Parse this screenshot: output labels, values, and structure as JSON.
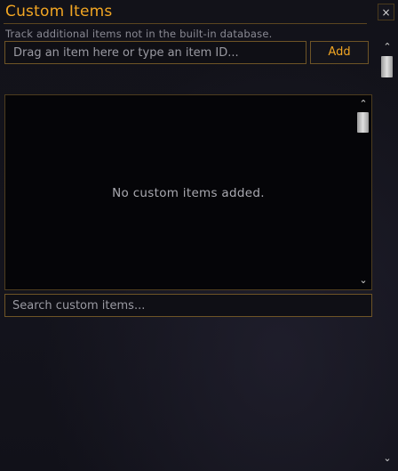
{
  "header": {
    "title": "Custom Items",
    "close_glyph": "×",
    "close_icon": "close-icon"
  },
  "description": "Track additional items not in the built-in database.",
  "add_item": {
    "placeholder": "Drag an item here or type an item ID...",
    "value": "",
    "button_label": "Add"
  },
  "list": {
    "empty_message": "No custom items added.",
    "scroll_up_glyph": "⌃",
    "scroll_down_glyph": "⌄"
  },
  "search": {
    "placeholder": "Search custom items...",
    "value": ""
  },
  "outer_scrollbar": {
    "scroll_up_glyph": "⌃",
    "scroll_down_glyph": "⌄"
  },
  "colors": {
    "accent": "#f2a623",
    "border": "#6e5426",
    "background": "#121219"
  }
}
